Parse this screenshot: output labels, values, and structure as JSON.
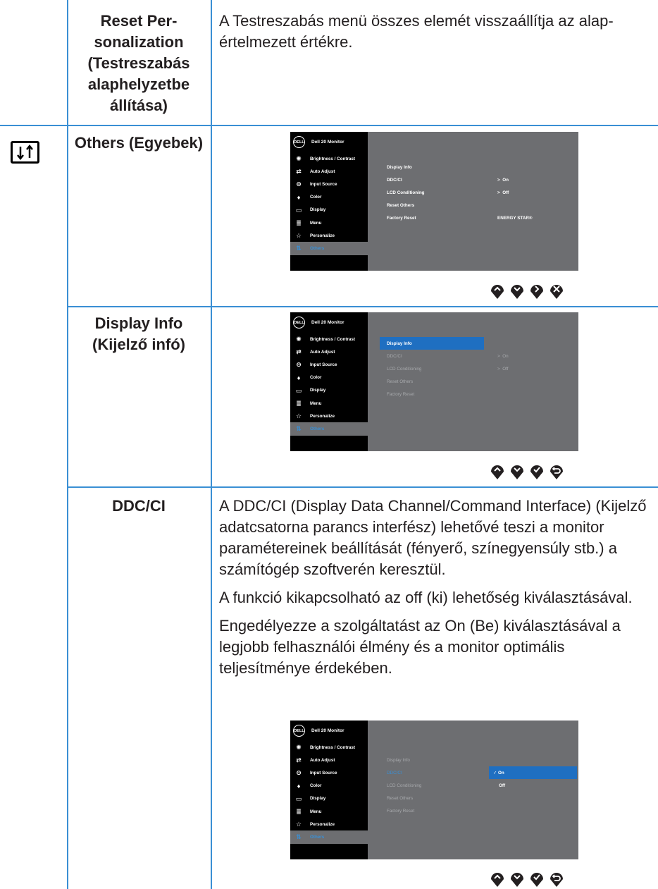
{
  "rows": {
    "reset_personalization": {
      "label": "Reset Per­sonalization (Testreszabás alaphelyzetbe állítása)",
      "description": "A Testreszabás menü összes elemét visszaállítja az alap­értelmezett értékre."
    },
    "others": {
      "icon": "others-sliders-icon",
      "label": "Others (Egye­bek)"
    },
    "display_info": {
      "label": "Display Info (Kijelző infó)"
    },
    "ddc_ci": {
      "label": "DDC/CI",
      "paragraphs": [
        "A DDC/CI (Display Data Channel/Command Interface) (Kijelző adatcsatorna parancs interfész) lehetővé teszi a monitor paramétereinek beállítását (fényerő, színegyen­súly stb.) a számítógép szoftverén keresztül.",
        "A funkció kikapcsolható az off (ki) lehetőség kiválasztá­sával.",
        "Engedélyezze a szolgáltatást az On (Be) kiválasztásá­val a legjobb felhasználói élmény és a monitor optimális teljesítménye érdekében."
      ]
    }
  },
  "osd": {
    "logo": "DELL",
    "model": "Dell 20 Monitor",
    "menu": [
      "Brightness / Contrast",
      "Auto Adjust",
      "Input Source",
      "Color",
      "Display",
      "Menu",
      "Personalize",
      "Others"
    ],
    "menu_icons": [
      "brightness-icon",
      "auto-adjust-icon",
      "input-source-icon",
      "color-icon",
      "display-icon",
      "menu-icon",
      "personalize-star-icon",
      "others-icon"
    ],
    "options": [
      "Display Info",
      "DDC/CI",
      "LCD Conditioning",
      "Reset Others",
      "Factory Reset"
    ],
    "ddc_value": "On",
    "lcd_value": "Off",
    "energy_star": "ENERGY STAR®",
    "ddc_choices": [
      "On",
      "Off"
    ]
  },
  "colors": {
    "rule": "#3a8fd4",
    "osd_bg": "#6d6e71",
    "highlight": "#1f6fc1"
  }
}
